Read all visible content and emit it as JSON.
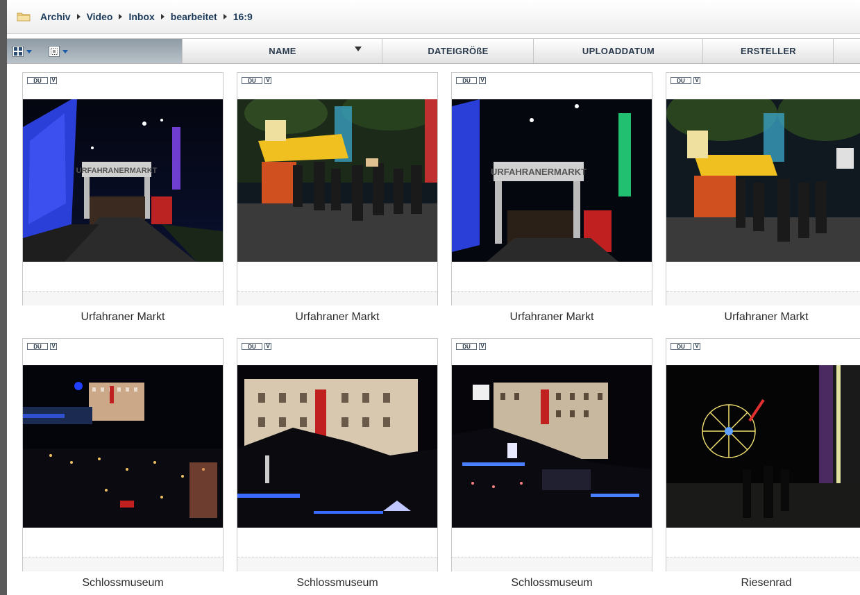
{
  "breadcrumb": [
    "Archiv",
    "Video",
    "Inbox",
    "bearbeitet",
    "16:9"
  ],
  "columns": {
    "name": "NAME",
    "size": "DATEIGRÖßE",
    "upload": "UPLOADDATUM",
    "creator": "ERSTELLER"
  },
  "badges": {
    "du": "DU",
    "v": "V"
  },
  "items": [
    {
      "caption": "Urfahraner Markt",
      "scene": "gate-blue"
    },
    {
      "caption": "Urfahraner Markt",
      "scene": "market"
    },
    {
      "caption": "Urfahraner Markt",
      "scene": "gate-wheel"
    },
    {
      "caption": "Urfahraner Markt",
      "scene": "market2"
    },
    {
      "caption": "Schlossmuseum",
      "scene": "city"
    },
    {
      "caption": "Schlossmuseum",
      "scene": "castle"
    },
    {
      "caption": "Schlossmuseum",
      "scene": "castle2"
    },
    {
      "caption": "Riesenrad",
      "scene": "wheel"
    }
  ],
  "thumb_texts": {
    "gate": "URFAHRANERMARKT"
  },
  "colors": {
    "crumb": "#1c3a5a",
    "accent": "#1a5aa6"
  }
}
